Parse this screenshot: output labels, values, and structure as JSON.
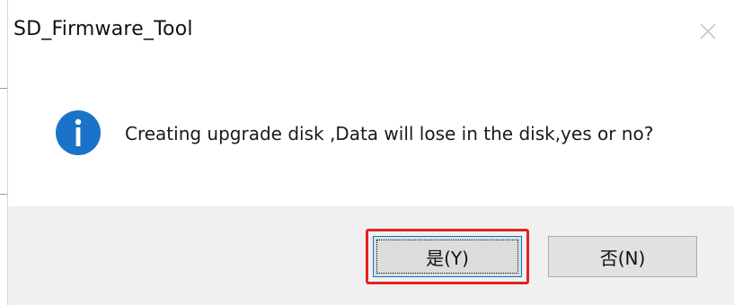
{
  "window": {
    "title": "SD_Firmware_Tool"
  },
  "dialog": {
    "icon": "info-icon",
    "message": "Creating upgrade disk ,Data will lose in the disk,yes or no?"
  },
  "buttons": {
    "yes_label": "是(Y)",
    "no_label": "否(N)"
  },
  "colors": {
    "info_icon": "#1a73c8",
    "highlight": "#e32222",
    "footer_bg": "#f0f0f0",
    "focus_border": "#0078d7"
  }
}
